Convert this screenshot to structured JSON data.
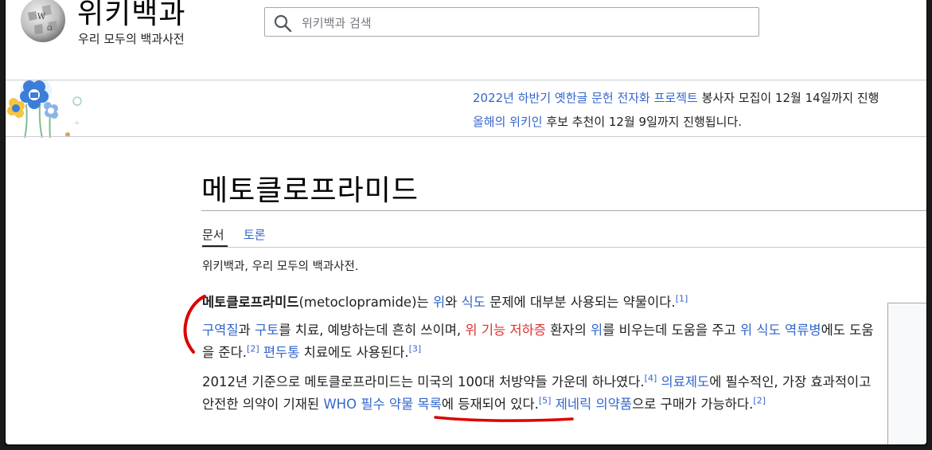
{
  "header": {
    "wordmark": "위키백과",
    "tagline": "우리 모두의 백과사전",
    "search_placeholder": "위키백과 검색"
  },
  "banner": {
    "line1": {
      "link": "2022년 하반기 옛한글 문헌 전자화 프로젝트",
      "text": " 봉사자 모집이 12월 14일까지 진행"
    },
    "line2": {
      "link": "올해의 위키인",
      "text": " 후보 추천이 12월 9일까지 진행됩니다."
    }
  },
  "article": {
    "title": "메토클로프라미드",
    "tabs": [
      "문서",
      "토론"
    ],
    "site_sub": "위키백과, 우리 모두의 백과사전.",
    "p1": {
      "bold": "메토클로프라미드",
      "t1": "(metoclopramide)는 ",
      "l1": "위",
      "t2": "와 ",
      "l2": "식도",
      "t3": " 문제에 대부분 사용되는 약물이다.",
      "ref1": "[1]"
    },
    "p2": {
      "l1": "구역질",
      "t1": "과 ",
      "l2": "구토",
      "t2": "를 치료, 예방하는데 흔히 쓰이며, ",
      "r1": "위 기능 저하증",
      "t3": " 환자의 ",
      "l3": "위",
      "t4": "를 비우는데 도움을 주고 ",
      "l4": "위 식도 역류병",
      "t5": "에도 도움을 준다.",
      "ref2": "[2]",
      "t6": " ",
      "l5": "편두통",
      "t7": " 치료에도 사용된다.",
      "ref3": "[3]"
    },
    "p3": {
      "t1": "2012년 기준으로 메토클로프라미드는 미국의 100대 처방약들 가운데 하나였다.",
      "ref4": "[4]",
      "t2": " ",
      "l1": "의료제도",
      "t3": "에 필수적인, 가장 효과적이고 안전한 의약이 기재된 ",
      "l2": "WHO 필수 약물 목록",
      "t4": "에 등재되어 있다.",
      "ref5": "[5]",
      "t5": " ",
      "l3": "제네릭 의약품",
      "t6": "으로 구매가 가능하다.",
      "ref6": "[2]"
    }
  },
  "colors": {
    "link": "#3366cc",
    "redlink": "#dd3333",
    "text": "#202122",
    "annotation": "#dd0000"
  }
}
